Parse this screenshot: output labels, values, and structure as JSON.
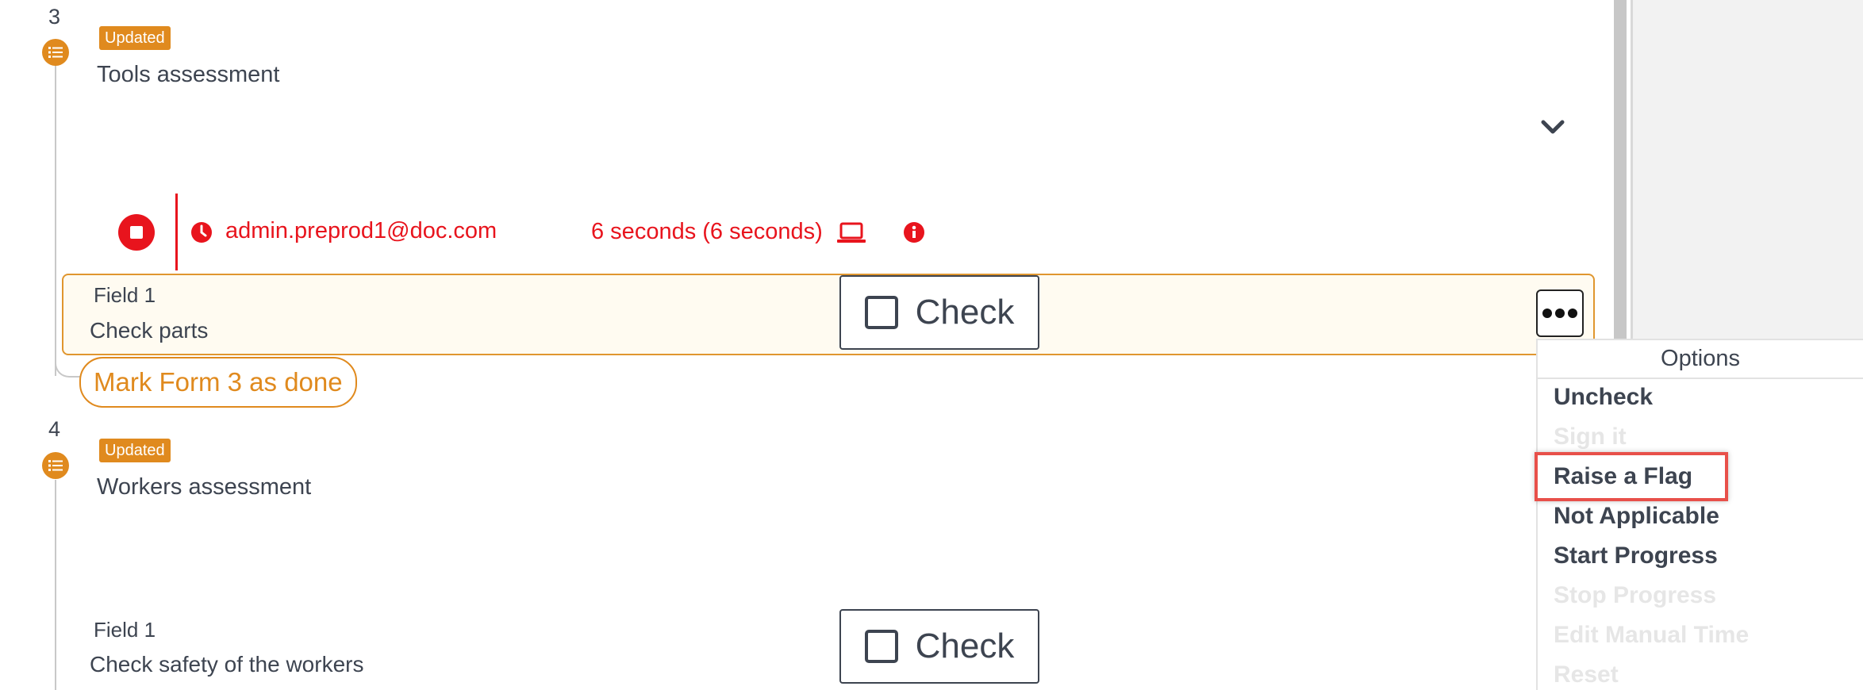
{
  "steps": [
    {
      "number": "3",
      "badge": "Updated",
      "title": "Tools assessment",
      "recording": {
        "user": "admin.preprod1@doc.com",
        "duration": "6 seconds (6 seconds)"
      },
      "field": {
        "label": "Field 1",
        "text": "Check parts",
        "check_label": "Check"
      },
      "mark_done": "Mark Form 3 as done"
    },
    {
      "number": "4",
      "badge": "Updated",
      "title": "Workers assessment",
      "field": {
        "label": "Field 1",
        "text": "Check safety of the workers",
        "check_label": "Check"
      }
    }
  ],
  "options_menu": {
    "header": "Options",
    "items": [
      {
        "label": "Uncheck",
        "enabled": true
      },
      {
        "label": "Sign it",
        "enabled": false
      },
      {
        "label": "Raise a Flag",
        "enabled": true,
        "highlighted": true
      },
      {
        "label": "Not Applicable",
        "enabled": true
      },
      {
        "label": "Start Progress",
        "enabled": true
      },
      {
        "label": "Stop Progress",
        "enabled": false
      },
      {
        "label": "Edit Manual Time",
        "enabled": false
      },
      {
        "label": "Reset",
        "enabled": false
      }
    ]
  },
  "colors": {
    "accent": "#e08a1e",
    "danger": "#e8141d",
    "text": "#3d4450",
    "highlight": "#e8504a"
  }
}
